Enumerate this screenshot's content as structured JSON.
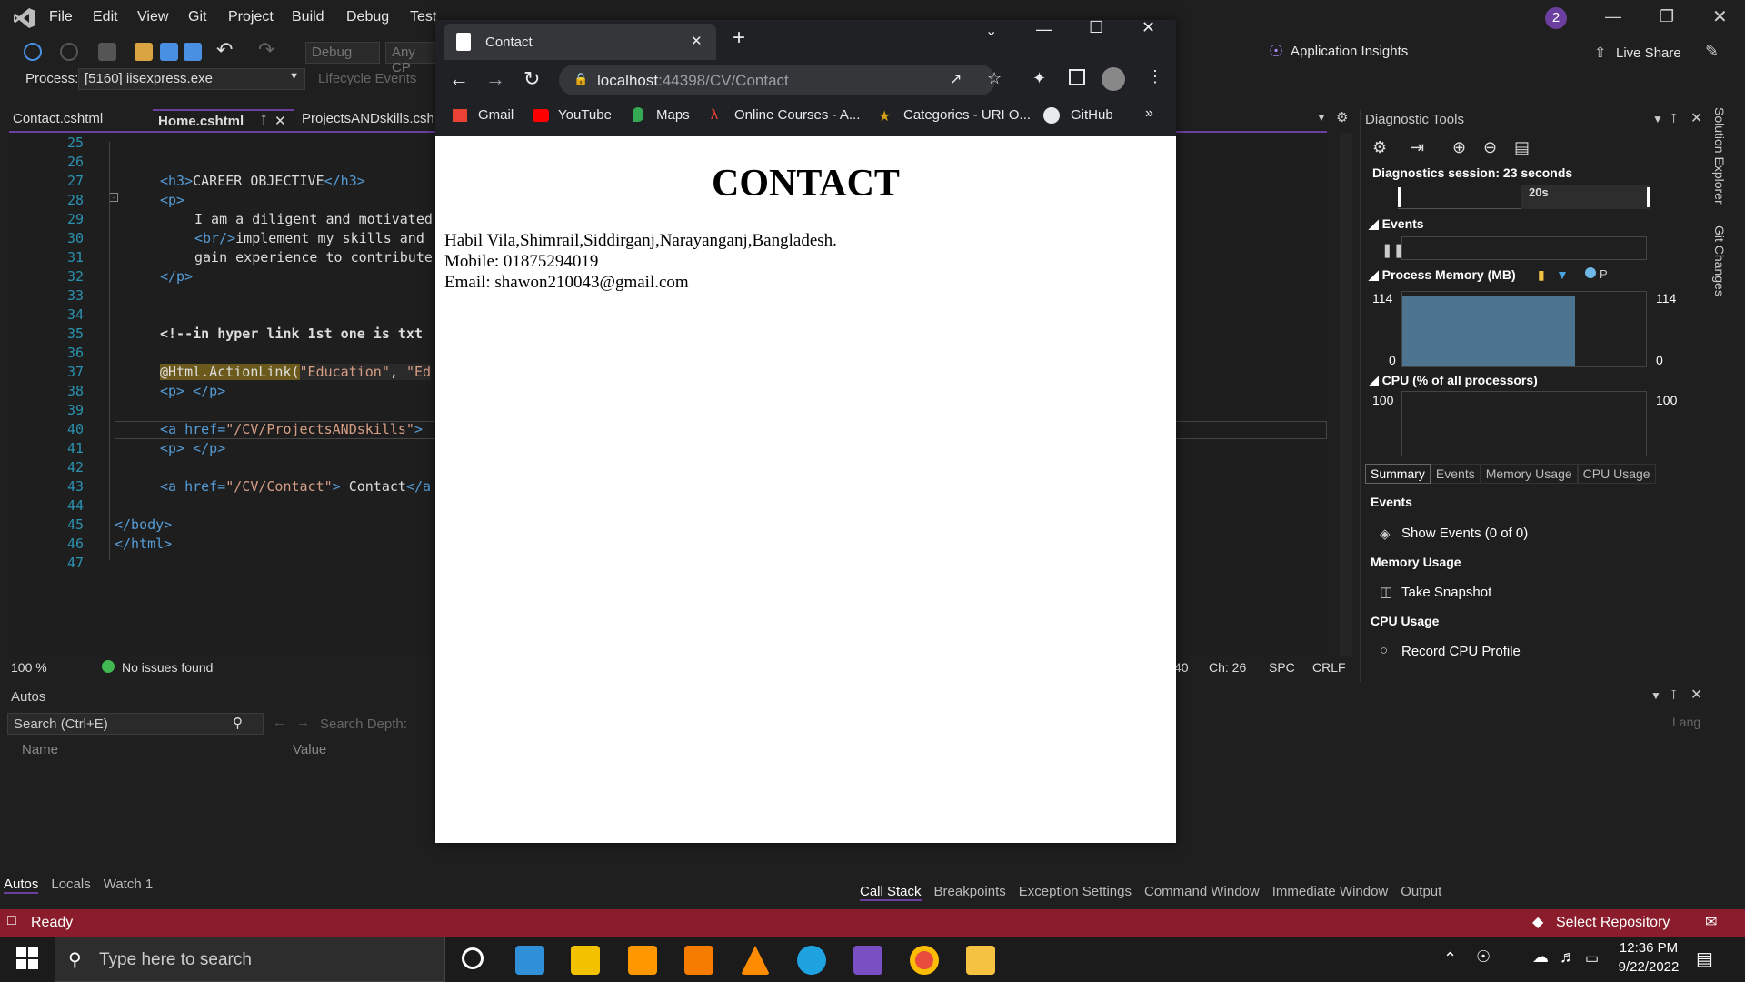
{
  "vs": {
    "menu": [
      "File",
      "Edit",
      "View",
      "Git",
      "Project",
      "Build",
      "Debug",
      "Test"
    ],
    "notif_count": "2",
    "debug_config": "Debug",
    "platform": "Any CP",
    "app_insights": "Application Insights",
    "live_share": "Live Share",
    "process_label": "Process:",
    "process_value": "[5160] iisexpress.exe",
    "lifecycle": "Lifecycle Events",
    "tabs": [
      "Contact.cshtml",
      "Home.cshtml",
      "ProjectsANDskills.cshtml"
    ],
    "zoom": "100 %",
    "issues": "No issues found",
    "ln_col": "40",
    "ch": "Ch: 26",
    "spc": "SPC",
    "crlf": "CRLF",
    "status_ready": "Ready",
    "select_repo": "Select Repository"
  },
  "code": {
    "lines": [
      "25",
      "26",
      "27",
      "28",
      "29",
      "30",
      "31",
      "32",
      "33",
      "34",
      "35",
      "36",
      "37",
      "38",
      "39",
      "40",
      "41",
      "42",
      "43",
      "44",
      "45",
      "46",
      "47"
    ],
    "l27_open": "<h3>",
    "l27_text": "CAREER OBJECTIVE",
    "l27_close": "</h3>",
    "l28": "<p>",
    "l29": "I am a diligent and motivated",
    "l30_tag": "<br/>",
    "l30_text": "implement my skills and",
    "l31": "gain experience to contribute",
    "l32": "</p>",
    "l35": "<!--in hyper link 1st one is txt",
    "l37_a": "@Html.ActionLink(",
    "l37_b": "\"Education\"",
    "l37_c": ", ",
    "l37_d": "\"Ed",
    "l38": "<p> </p>",
    "l40_a": "<a href=",
    "l40_b": "\"/CV/ProjectsANDskills\"",
    "l40_c": ">",
    "l41": "<p> </p>",
    "l43_a": "<a href=",
    "l43_b": "\"/CV/Contact\"",
    "l43_c": ">",
    "l43_d": " Contact",
    "l43_e": "</a",
    "l45": "</body>",
    "l46": "</html>"
  },
  "autos": {
    "title": "Autos",
    "search_placeholder": "Search (Ctrl+E)",
    "search_depth": "Search Depth:",
    "col_name": "Name",
    "col_value": "Value",
    "tabs": [
      "Autos",
      "Locals",
      "Watch 1"
    ],
    "lang": "Lang"
  },
  "bottom_right_tabs": [
    "Call Stack",
    "Breakpoints",
    "Exception Settings",
    "Command Window",
    "Immediate Window",
    "Output"
  ],
  "diagnostics": {
    "title": "Diagnostic Tools",
    "session": "Diagnostics session: 23 seconds",
    "time_marker": "20s",
    "events_label": "Events",
    "process_memory": "Process Memory (MB)",
    "legend_p": "P",
    "mem_max": "114",
    "mem_min": "0",
    "cpu_label": "CPU (% of all processors)",
    "cpu_max": "100",
    "tabs": [
      "Summary",
      "Events",
      "Memory Usage",
      "CPU Usage"
    ],
    "sec_events": "Events",
    "show_events": "Show Events (0 of 0)",
    "sec_memory": "Memory Usage",
    "take_snapshot": "Take Snapshot",
    "sec_cpu": "CPU Usage",
    "record_cpu": "Record CPU Profile",
    "side_tabs": [
      "Solution Explorer",
      "Git Changes"
    ]
  },
  "chrome": {
    "tab_title": "Contact",
    "url_host": "localhost",
    "url_path": ":44398/CV/Contact",
    "bookmarks": [
      "Gmail",
      "YouTube",
      "Maps",
      "Online Courses - A...",
      "Categories - URI O...",
      "GitHub"
    ]
  },
  "page": {
    "heading": "CONTACT",
    "address": "Habil Vila,Shimrail,Siddirganj,Narayanganj,Bangladesh.",
    "mobile": "Mobile: 01875294019",
    "email": "Email: shawon210043@gmail.com"
  },
  "taskbar": {
    "search_placeholder": "Type here to search",
    "time": "12:36 PM",
    "date": "9/22/2022"
  }
}
